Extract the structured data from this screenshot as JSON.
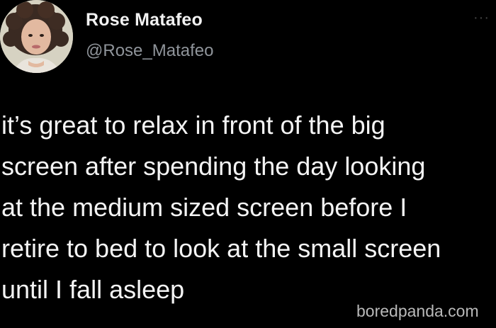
{
  "tweet": {
    "author": {
      "display_name": "Rose Matafeo",
      "handle": "@Rose_Matafeo",
      "avatar_icon": "profile-photo"
    },
    "more_icon": "more-options-icon",
    "text_lines": [
      "it’s great to relax in front of the big",
      "screen after spending the day looking",
      "at the medium sized screen before I",
      "retire to bed to look at the small screen",
      "until I fall asleep"
    ]
  },
  "watermark": "boredpanda.com",
  "colors": {
    "background": "#000000",
    "text": "#f4f4f4",
    "handle": "#8f949a",
    "watermark": "#b9b9b9"
  }
}
